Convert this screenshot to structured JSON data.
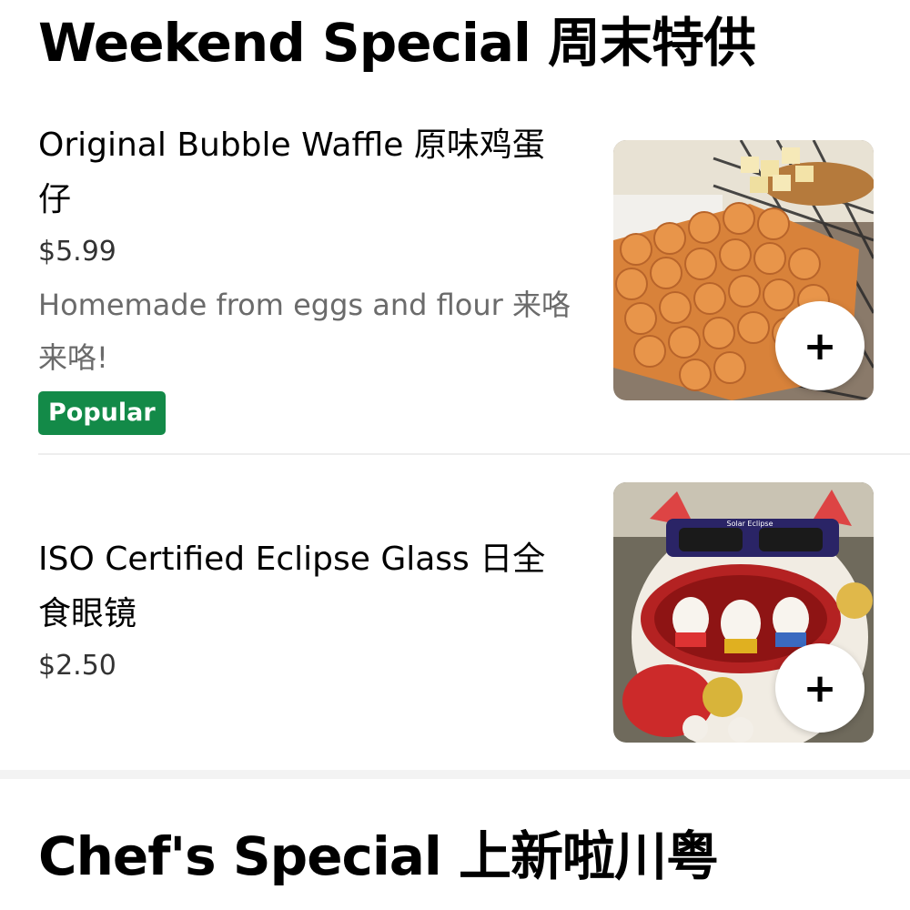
{
  "sections": [
    {
      "title": "Weekend Special 周末特供",
      "items": [
        {
          "name": "Original Bubble Waffle 原味鸡蛋仔",
          "price": "$5.99",
          "description": "Homemade from eggs and flour 来咯来咯!",
          "badge": "Popular",
          "add_label": "+",
          "image": "bubble-waffle-photo"
        },
        {
          "name": "ISO Certified Eclipse Glass 日全食眼镜",
          "price": "$2.50",
          "add_label": "+",
          "image": "lucky-cat-eclipse-glasses-photo",
          "image_text": "Solar Eclipse"
        }
      ]
    },
    {
      "title": "Chef's Special 上新啦川粤"
    }
  ],
  "colors": {
    "badge_green": "#138a48",
    "text_primary": "#000000",
    "text_secondary": "#6b6b6b",
    "divider": "#eeeeee"
  }
}
